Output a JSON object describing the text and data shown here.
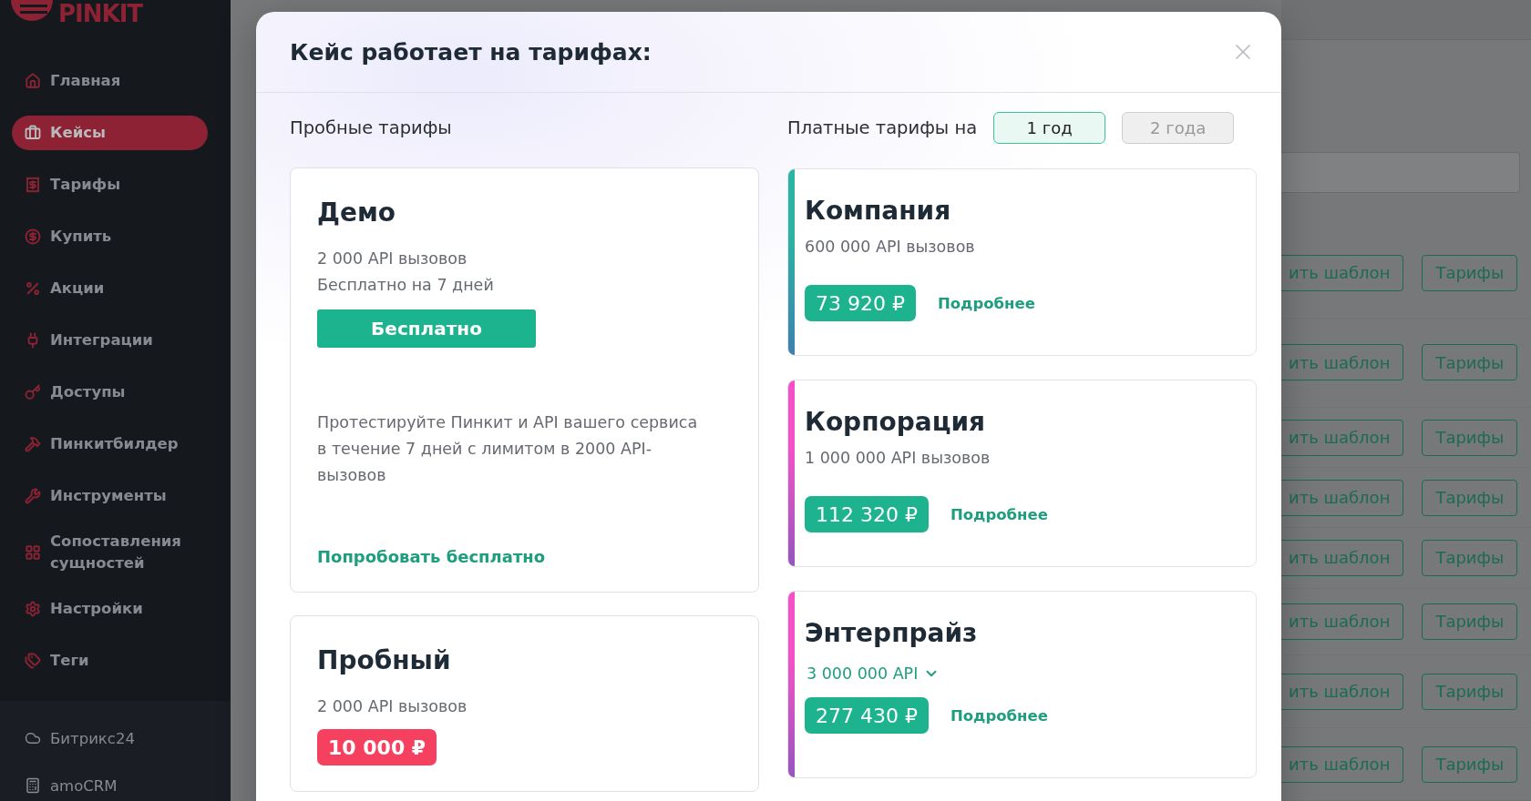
{
  "sidebar": {
    "logo": "PINKIT",
    "items": [
      {
        "label": "Главная",
        "selected": false
      },
      {
        "label": "Кейсы",
        "selected": true
      },
      {
        "label": "Тарифы",
        "selected": false
      },
      {
        "label": "Купить",
        "selected": false
      },
      {
        "label": "Акции",
        "selected": false
      },
      {
        "label": "Интеграции",
        "selected": false
      },
      {
        "label": "Доступы",
        "selected": false
      },
      {
        "label": "Пинкитбилдер",
        "selected": false
      },
      {
        "label": "Инструменты",
        "selected": false
      },
      {
        "label": "Сопоставления сущностей",
        "selected": false
      },
      {
        "label": "Настройки",
        "selected": false
      },
      {
        "label": "Теги",
        "selected": false
      }
    ],
    "integrations": [
      {
        "label": "Битрикс24"
      },
      {
        "label": "amoCRM"
      }
    ]
  },
  "background_rows": [
    {
      "template_button": "ить шаблон",
      "tariffs_button": "Тарифы"
    },
    {
      "template_button": "ить шаблон",
      "tariffs_button": "Тарифы"
    },
    {
      "template_button": "ить шаблон",
      "tariffs_button": "Тарифы"
    },
    {
      "template_button": "ить шаблон",
      "tariffs_button": "Тарифы"
    },
    {
      "template_button": "ить шаблон",
      "tariffs_button": "Тарифы"
    },
    {
      "template_button": "ить шаблон",
      "tariffs_button": "Тарифы"
    },
    {
      "template_button": "ить шаблон",
      "tariffs_button": "Тарифы"
    },
    {
      "template_button": "ить шаблон",
      "tariffs_button": "Тарифы"
    }
  ],
  "modal": {
    "title": "Кейс работает на тарифах:",
    "trial_heading": "Пробные тарифы",
    "paid_heading": "Платные тарифы на",
    "periods": [
      {
        "label": "1 год",
        "selected": true
      },
      {
        "label": "2 года",
        "selected": false
      }
    ],
    "trial_plans": [
      {
        "title": "Демо",
        "lines": [
          "2 000 API вызовов",
          "Бесплатно на 7 дней"
        ],
        "action": "Бесплатно",
        "description": "Протестируйте Пинкит и API вашего сервиса в течение 7 дней с лимитом в 2000 API-вызовов",
        "link": "Попробовать бесплатно"
      },
      {
        "title": "Пробный",
        "lines": [
          "2 000 API вызовов"
        ],
        "price": {
          "text": "10 000 ₽",
          "color": "#f5415f"
        }
      }
    ],
    "paid_plans": [
      {
        "title": "Компания",
        "color": "#2bb3a3",
        "calls": {
          "kind": "static",
          "text": "600 000 API вызовов"
        },
        "price": {
          "text": "73 920 ₽",
          "color": "#1db38f"
        },
        "link": "Подробнее"
      },
      {
        "title": "Корпорация",
        "color": "#f550c8",
        "calls": {
          "kind": "static",
          "text": "1 000 000 API вызовов"
        },
        "price": {
          "text": "112 320 ₽",
          "color": "#1db38f"
        },
        "link": "Подробнее"
      },
      {
        "title": "Энтерпрайз",
        "color": "#f550c8",
        "calls": {
          "kind": "select",
          "text": "3 000 000 API"
        },
        "price": {
          "text": "277 430 ₽",
          "color": "#1db38f"
        },
        "link": "Подробнее"
      }
    ]
  }
}
